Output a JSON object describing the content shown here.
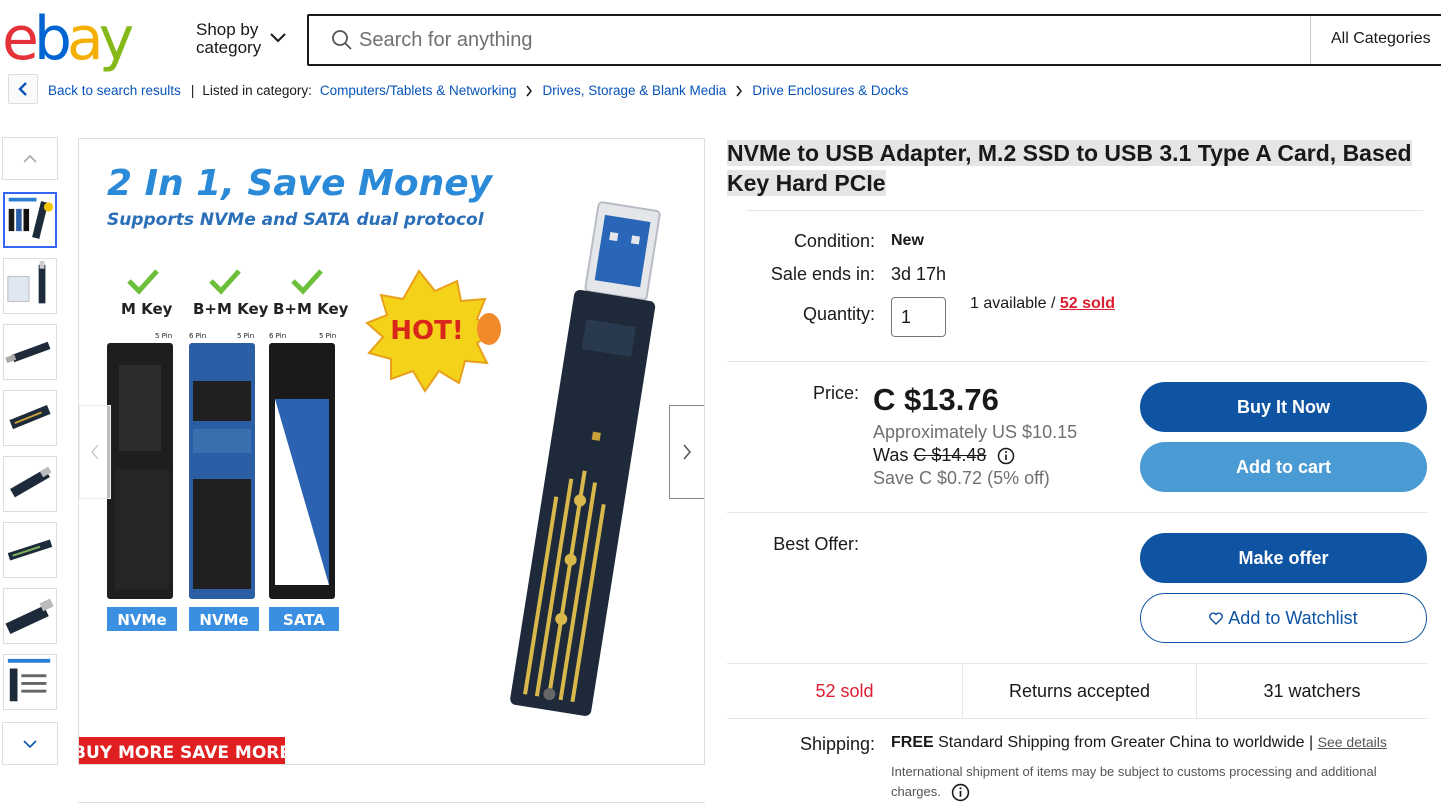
{
  "header": {
    "logo_letters": [
      "e",
      "b",
      "a",
      "y"
    ],
    "logo_colors": [
      "#e53238",
      "#0064d2",
      "#f5af02",
      "#86b817"
    ],
    "shop_by_line1": "Shop by",
    "shop_by_line2": "category",
    "search_placeholder": "Search for anything",
    "all_categories": "All Categories"
  },
  "breadcrumb": {
    "back": "Back to search results",
    "listed_in": "Listed in category:",
    "items": [
      "Computers/Tablets & Networking",
      "Drives, Storage & Blank Media",
      "Drive Enclosures & Docks"
    ]
  },
  "gallery": {
    "headline": "2 In 1, Save Money",
    "subheadline": "Supports NVMe and SATA dual protocol",
    "keys": [
      "M Key",
      "B+M Key",
      "B+M Key"
    ],
    "protocols": [
      "NVMe",
      "NVMe",
      "SATA"
    ],
    "pin_labels": [
      "5 Pin",
      "6 Pin",
      "5 Pin",
      "6 Pin",
      "5 Pin"
    ],
    "badge": "HOT!",
    "banner": "BUY MORE SAVE MORE",
    "thumb_count": 8
  },
  "product": {
    "title_line1": "NVMe to USB Adapter, M.2 SSD to USB 3.1 Type A Card, Based",
    "title_line2": "Key Hard PCIe",
    "condition_label": "Condition:",
    "condition": "New",
    "sale_label": "Sale ends in:",
    "sale_ends": "3d 17h",
    "quantity_label": "Quantity:",
    "quantity": "1",
    "available": "1 available /",
    "sold_link": "52 sold",
    "price_label": "Price:",
    "price": "C $13.76",
    "approx": "Approximately US $10.15",
    "was_label": "Was",
    "was_price": "C $14.48",
    "save": "Save C $0.72 (5% off)",
    "best_offer_label": "Best Offer:"
  },
  "actions": {
    "buy_now": "Buy It Now",
    "add_to_cart": "Add to cart",
    "make_offer": "Make offer",
    "watchlist": "Add to Watchlist"
  },
  "stats": {
    "sold": "52 sold",
    "returns": "Returns accepted",
    "watchers": "31 watchers"
  },
  "shipping": {
    "label": "Shipping:",
    "free": "FREE",
    "text": "Standard Shipping from Greater China to worldwide",
    "separator": "|",
    "see_details": "See details",
    "note": "International shipment of items may be subject to customs processing and additional charges."
  },
  "colors": {
    "link": "#0654ba",
    "primary_button": "#0f53a3",
    "secondary_button": "#4a9bd4",
    "sold_red": "#dd1e31"
  }
}
